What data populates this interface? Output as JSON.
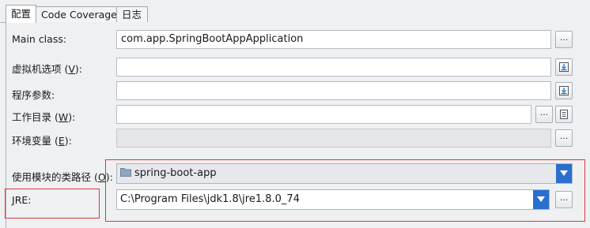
{
  "tabs": [
    {
      "label": "配置",
      "active": true
    },
    {
      "label": "Code Coverage",
      "active": false
    },
    {
      "label": "日志",
      "active": false
    }
  ],
  "form": {
    "main_class": {
      "label": "Main class:",
      "value": "com.app.SpringBootAppApplication"
    },
    "vm_options": {
      "label_pre": "虚拟机选项 (",
      "mnemonic": "V",
      "label_post": "):",
      "value": ""
    },
    "program_args": {
      "label": "程序参数:",
      "value": ""
    },
    "working_dir": {
      "label_pre": "工作目录 (",
      "mnemonic": "W",
      "label_post": "):",
      "value": ""
    },
    "env_vars": {
      "label_pre": "环境变量 (",
      "mnemonic": "E",
      "label_post": "):",
      "value": ""
    },
    "module_classpath": {
      "label_pre": "使用模块的类路径 (",
      "mnemonic": "O",
      "label_post": "):",
      "value": "spring-boot-app"
    },
    "jre": {
      "mnemonic": "J",
      "label_post": "RE:",
      "value": "C:\\Program Files\\jdk1.8\\jre1.8.0_74"
    }
  },
  "buttons": {
    "browse_label": "..."
  },
  "colors": {
    "accent": "#2a6fcf",
    "highlight_box": "#d93a3a",
    "background": "#eef0f2"
  },
  "icons": [
    "insert-macro-icon",
    "document-icon",
    "folder-icon",
    "chevron-down-icon"
  ]
}
